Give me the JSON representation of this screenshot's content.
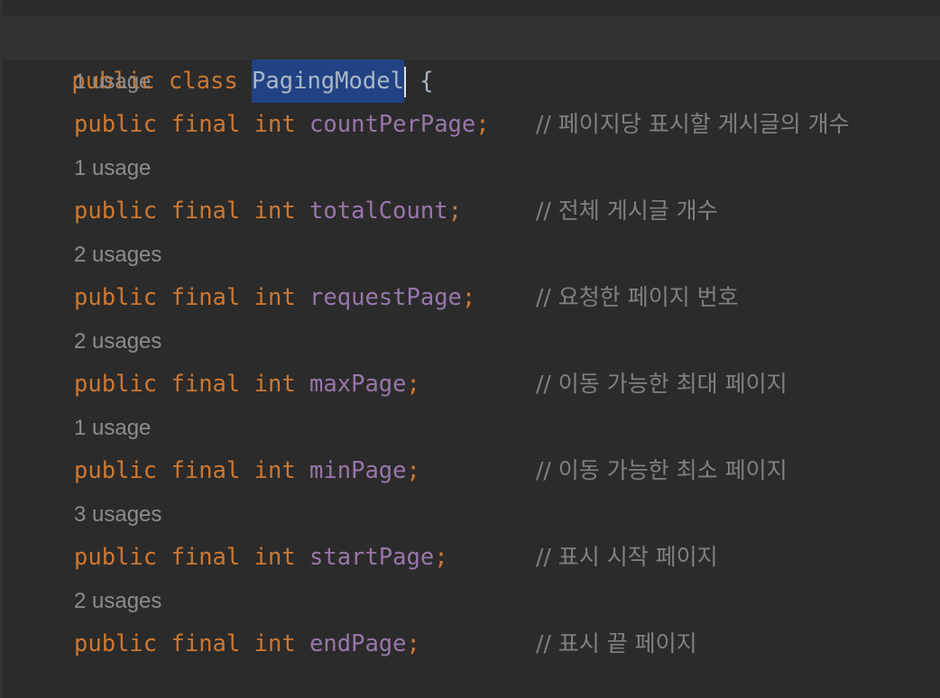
{
  "editor": {
    "class_declaration": {
      "modifier": "public",
      "keyword": "class",
      "class_name": "PagingModel",
      "open_brace": "{"
    },
    "fields": [
      {
        "usage_hint": "1 usage",
        "modifiers": [
          "public",
          "final"
        ],
        "type": "int",
        "name": "countPerPage",
        "semicolon": ";",
        "comment": "// 페이지당 표시할 게시글의 개수"
      },
      {
        "usage_hint": "1 usage",
        "modifiers": [
          "public",
          "final"
        ],
        "type": "int",
        "name": "totalCount",
        "semicolon": ";",
        "comment": "// 전체 게시글 개수"
      },
      {
        "usage_hint": "2 usages",
        "modifiers": [
          "public",
          "final"
        ],
        "type": "int",
        "name": "requestPage",
        "semicolon": ";",
        "comment": "// 요청한 페이지 번호"
      },
      {
        "usage_hint": "2 usages",
        "modifiers": [
          "public",
          "final"
        ],
        "type": "int",
        "name": "maxPage",
        "semicolon": ";",
        "comment": "// 이동 가능한 최대 페이지"
      },
      {
        "usage_hint": "1 usage",
        "modifiers": [
          "public",
          "final"
        ],
        "type": "int",
        "name": "minPage",
        "semicolon": ";",
        "comment": "// 이동 가능한 최소 페이지"
      },
      {
        "usage_hint": "3 usages",
        "modifiers": [
          "public",
          "final"
        ],
        "type": "int",
        "name": "startPage",
        "semicolon": ";",
        "comment": "// 표시 시작 페이지"
      },
      {
        "usage_hint": "2 usages",
        "modifiers": [
          "public",
          "final"
        ],
        "type": "int",
        "name": "endPage",
        "semicolon": ";",
        "comment": "// 표시 끝 페이지"
      }
    ]
  },
  "colors": {
    "background": "#2b2b2b",
    "keyword": "#cc7832",
    "field": "#9876aa",
    "comment": "#808080",
    "hint": "#8c8c8c",
    "selection": "#214283"
  }
}
